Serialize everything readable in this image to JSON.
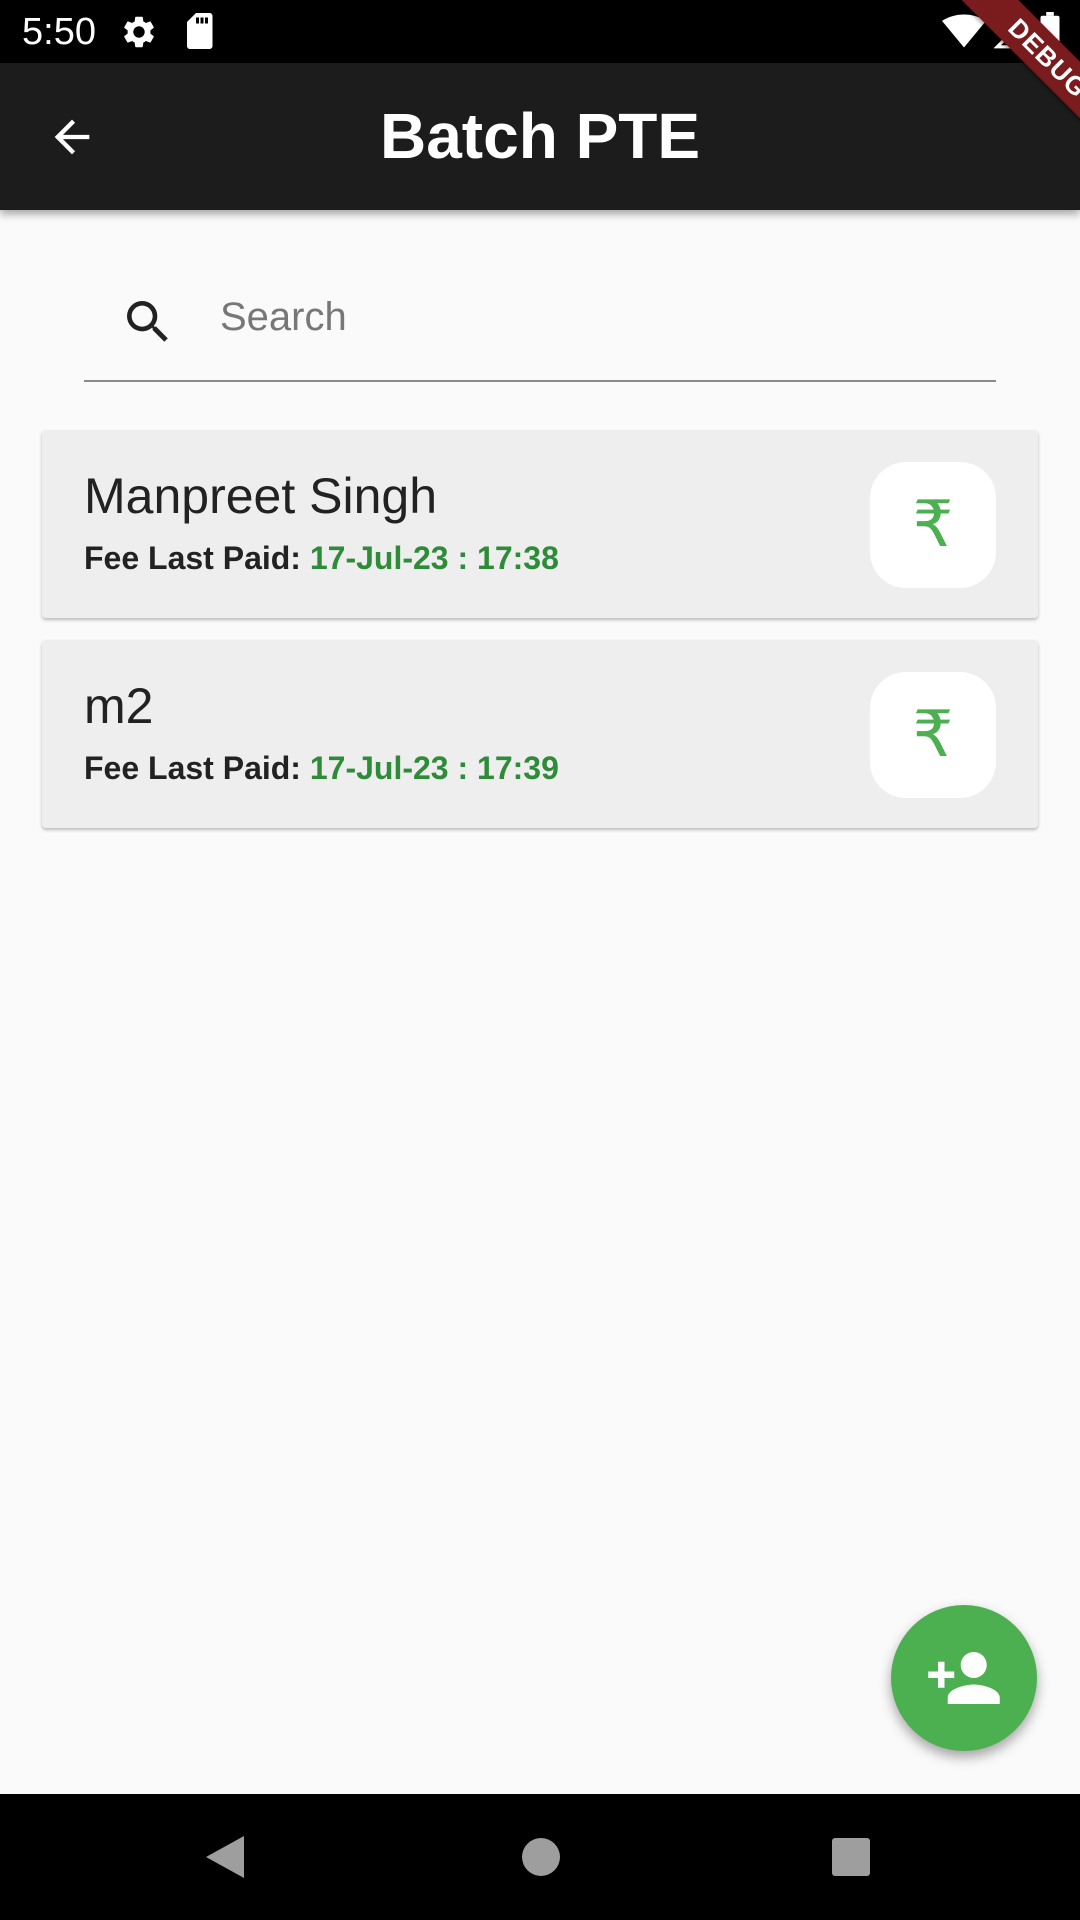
{
  "status_bar": {
    "time": "5:50",
    "icons": [
      "gear-icon",
      "sd-card-icon",
      "wifi-icon",
      "signal-icon",
      "battery-icon"
    ]
  },
  "debug_banner": "DEBUG",
  "app_bar": {
    "title": "Batch PTE",
    "back_icon": "arrow-back-icon"
  },
  "search": {
    "placeholder": "Search",
    "value": "",
    "icon": "search-icon"
  },
  "students": [
    {
      "name": "Manpreet Singh",
      "fee_label": "Fee Last Paid:",
      "fee_date": "17-Jul-23 : 17:38",
      "pay_icon": "₹"
    },
    {
      "name": "m2",
      "fee_label": "Fee Last Paid:",
      "fee_date": "17-Jul-23 : 17:39",
      "pay_icon": "₹"
    }
  ],
  "fab": {
    "icon": "person-add-icon"
  },
  "nav_bar": {
    "icons": [
      "nav-back-icon",
      "nav-home-icon",
      "nav-recents-icon"
    ]
  },
  "colors": {
    "app_bar": "#1c1c1c",
    "background": "#fafafa",
    "card": "#eeeeee",
    "accent_green": "#4caf50",
    "date_green": "#2e8b37"
  }
}
